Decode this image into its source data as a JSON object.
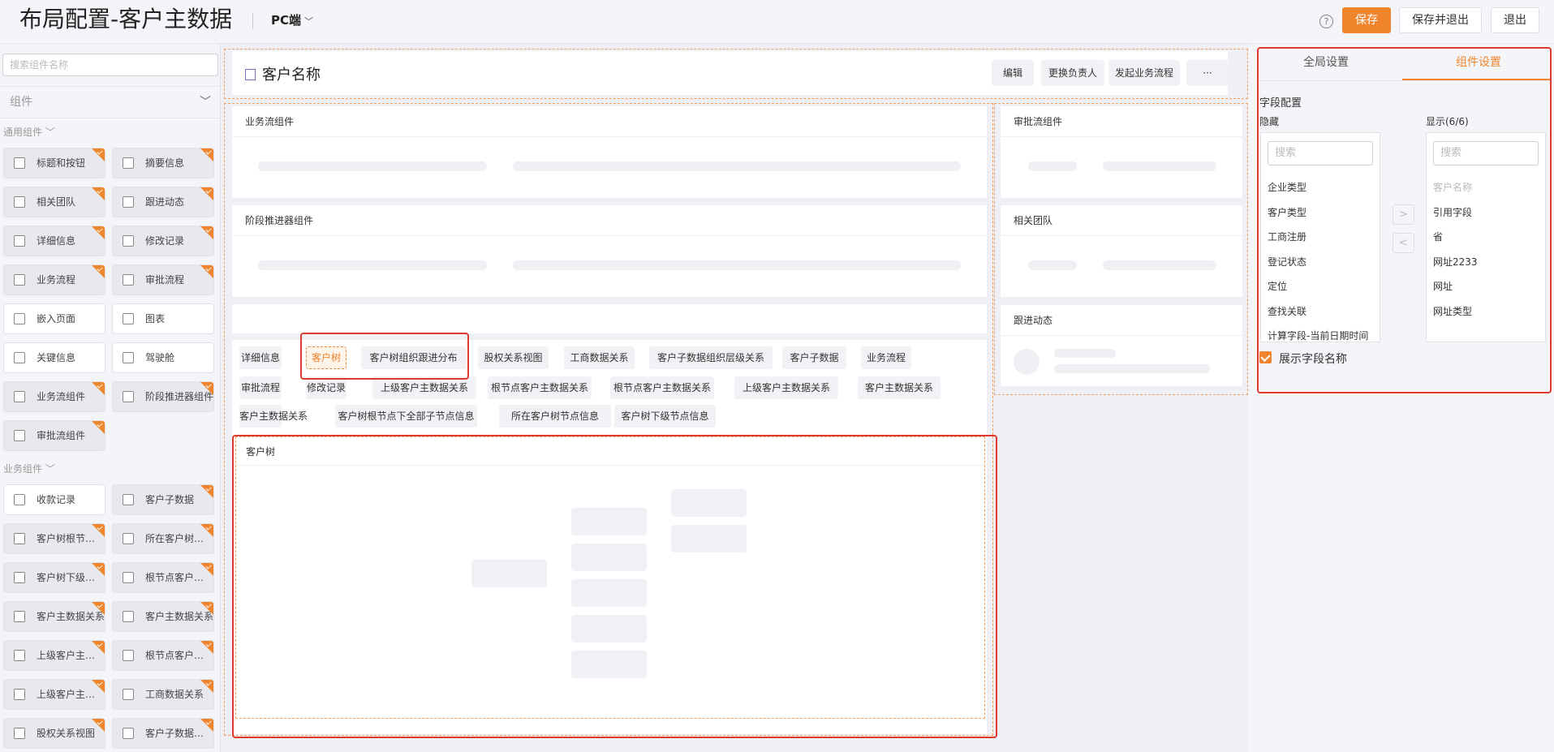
{
  "header": {
    "title": "布局配置-客户主数据",
    "platform": "PC端",
    "save": "保存",
    "save_exit": "保存并退出",
    "exit": "退出"
  },
  "left": {
    "search_placeholder": "搜索组件名称",
    "category": "组件",
    "group_general": "通用组件",
    "group_business": "业务组件",
    "general": [
      {
        "label": "标题和按钮",
        "white": false,
        "corner": true
      },
      {
        "label": "摘要信息",
        "white": false,
        "corner": true
      },
      {
        "label": "相关团队",
        "white": false,
        "corner": true
      },
      {
        "label": "跟进动态",
        "white": false,
        "corner": true
      },
      {
        "label": "详细信息",
        "white": false,
        "corner": true
      },
      {
        "label": "修改记录",
        "white": false,
        "corner": true
      },
      {
        "label": "业务流程",
        "white": false,
        "corner": true
      },
      {
        "label": "审批流程",
        "white": false,
        "corner": true
      },
      {
        "label": "嵌入页面",
        "white": true,
        "corner": false
      },
      {
        "label": "图表",
        "white": true,
        "corner": false
      },
      {
        "label": "关键信息",
        "white": true,
        "corner": false
      },
      {
        "label": "驾驶舱",
        "white": true,
        "corner": false
      },
      {
        "label": "业务流组件",
        "white": false,
        "corner": true
      },
      {
        "label": "阶段推进器组件",
        "white": false,
        "corner": true
      },
      {
        "label": "审批流组件",
        "white": false,
        "corner": true
      }
    ],
    "business": [
      {
        "label": "收款记录",
        "white": true,
        "corner": false
      },
      {
        "label": "客户子数据",
        "white": false,
        "corner": true
      },
      {
        "label": "客户树根节点下全部子节点信息",
        "white": false,
        "corner": true
      },
      {
        "label": "所在客户树节点信息",
        "white": false,
        "corner": true
      },
      {
        "label": "客户树下级节点信息",
        "white": false,
        "corner": true
      },
      {
        "label": "根节点客户主数据关系",
        "white": false,
        "corner": true
      },
      {
        "label": "客户主数据关系",
        "white": false,
        "corner": true
      },
      {
        "label": "客户主数据关系",
        "white": false,
        "corner": true
      },
      {
        "label": "上级客户主数据关系",
        "white": false,
        "corner": true
      },
      {
        "label": "根节点客户主数据关系",
        "white": false,
        "corner": true
      },
      {
        "label": "上级客户主数据关系",
        "white": false,
        "corner": true
      },
      {
        "label": "工商数据关系",
        "white": false,
        "corner": true
      },
      {
        "label": "股权关系视图",
        "white": false,
        "corner": true
      },
      {
        "label": "客户子数据组织层级关系",
        "white": false,
        "corner": true
      }
    ]
  },
  "canvas": {
    "customer_name": "客户名称",
    "header_buttons": [
      "编辑",
      "更换负责人",
      "发起业务流程",
      "···"
    ],
    "bizflow_title": "业务流组件",
    "stage_title": "阶段推进器组件",
    "approval_title": "审批流组件",
    "team_title": "相关团队",
    "follow_title": "跟进动态",
    "tabs_row1": [
      "详细信息",
      "客户树",
      "客户树组织跟进分布",
      "股权关系视图",
      "工商数据关系",
      "客户子数据组织层级关系",
      "客户子数据",
      "业务流程"
    ],
    "tabs_row2": [
      "审批流程",
      "修改记录",
      "上级客户主数据关系",
      "根节点客户主数据关系",
      "根节点客户主数据关系",
      "上级客户主数据关系",
      "客户主数据关系"
    ],
    "tabs_row3": [
      "客户主数据关系",
      "客户树根节点下全部子节点信息",
      "所在客户树节点信息",
      "客户树下级节点信息"
    ],
    "tree_title": "客户树"
  },
  "right": {
    "tab_global": "全局设置",
    "tab_component": "组件设置",
    "field_config": "字段配置",
    "hidden_label": "隐藏",
    "shown_label": "显示(6/6)",
    "search_placeholder": "搜索",
    "hidden_fields": [
      "企业类型",
      "客户类型",
      "工商注册",
      "登记状态",
      "定位",
      "查找关联",
      "计算字段-当前日期时间"
    ],
    "shown_fields": [
      "客户名称",
      "引用字段",
      "省",
      "网址2233",
      "网址",
      "网址类型"
    ],
    "show_field_name": "展示字段名称"
  },
  "colors": {
    "accent": "#f0852d",
    "annotation": "#e03a2f"
  }
}
